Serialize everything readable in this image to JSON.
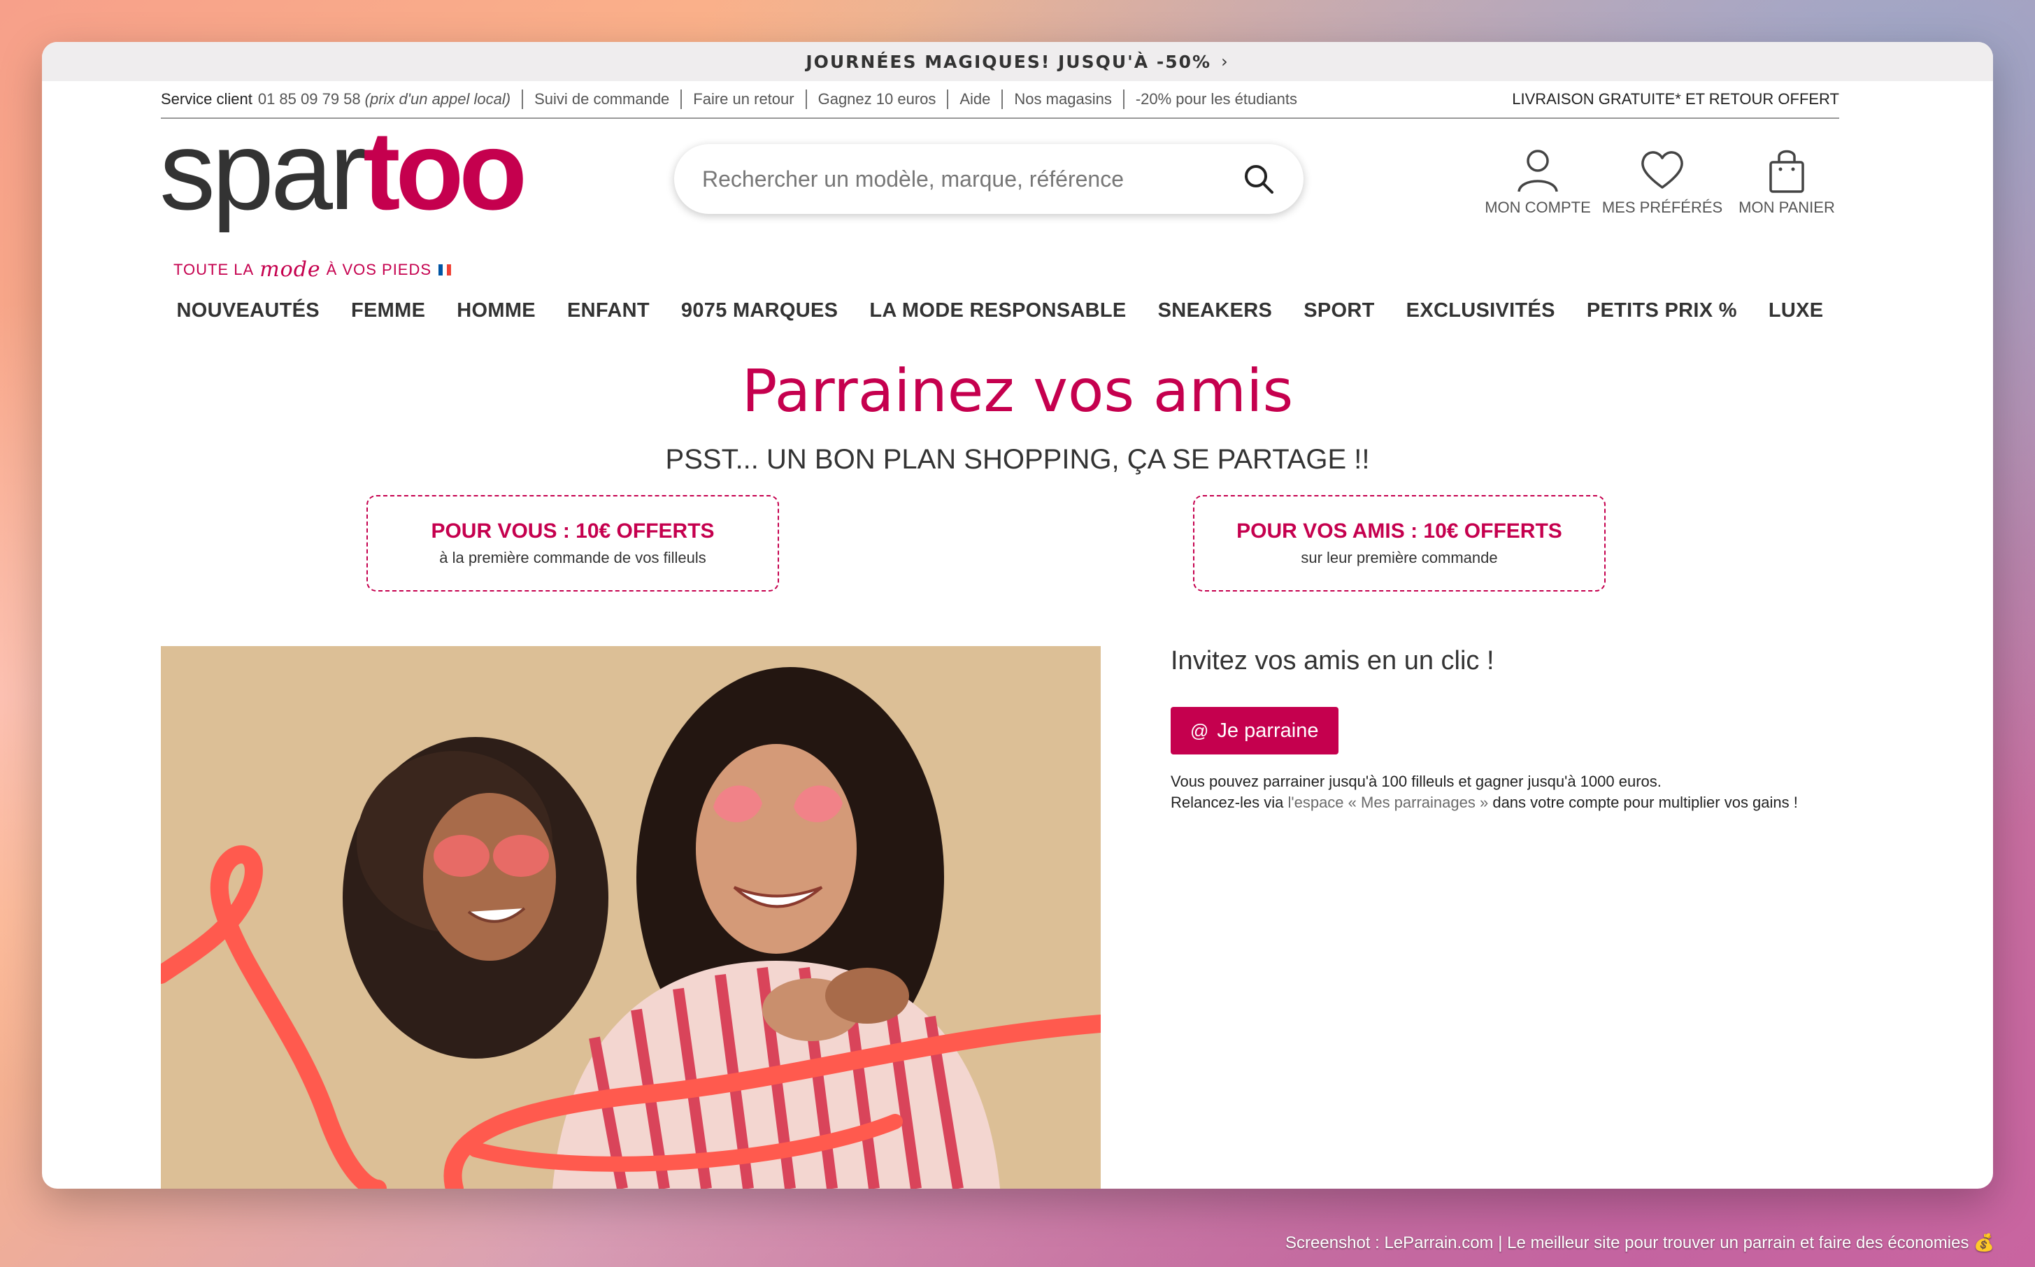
{
  "promo": {
    "text": "JOURNÉES MAGIQUES! JUSQU'À -50%",
    "chevron": "›"
  },
  "topbar": {
    "service_label": "Service client",
    "phone": "01 85 09 79 58",
    "phone_note": "(prix d'un appel local)",
    "links": [
      "Suivi de commande",
      "Faire un retour",
      "Gagnez 10 euros",
      "Aide",
      "Nos magasins",
      "-20% pour les étudiants"
    ],
    "right_text": "LIVRAISON GRATUITE* ET RETOUR OFFERT"
  },
  "logo": {
    "part1": "spar",
    "part2": "too",
    "tagline_a": "TOUTE LA",
    "tagline_mode": "mode",
    "tagline_b": "À VOS PIEDS"
  },
  "search": {
    "placeholder": "Rechercher un modèle, marque, référence",
    "icon": "search-icon"
  },
  "account": {
    "items": [
      {
        "label": "MON COMPTE",
        "icon": "user-icon"
      },
      {
        "label": "MES PRÉFÉRÉS",
        "icon": "heart-icon"
      },
      {
        "label": "MON PANIER",
        "icon": "shopping-bag-icon"
      }
    ]
  },
  "nav": {
    "items": [
      "NOUVEAUTÉS",
      "FEMME",
      "HOMME",
      "ENFANT",
      "9075 MARQUES",
      "LA MODE RESPONSABLE",
      "SNEAKERS",
      "SPORT",
      "EXCLUSIVITÉS",
      "PETITS PRIX %",
      "LUXE"
    ]
  },
  "hero": {
    "title": "Parrainez vos amis",
    "subtitle": "PSST... UN BON PLAN SHOPPING, ÇA SE PARTAGE !!"
  },
  "offers": [
    {
      "title": "POUR VOUS : 10€ OFFERTS",
      "subtitle": "à la première commande de vos filleuls"
    },
    {
      "title": "POUR VOS AMIS : 10€ OFFERTS",
      "subtitle": "sur leur première commande"
    }
  ],
  "invite": {
    "title": "Invitez vos amis en un clic !",
    "button_icon": "@",
    "button_label": "Je parraine",
    "text1": "Vous pouvez parrainer jusqu'à 100 filleuls et gagner jusqu'à 1000 euros.",
    "text2_a": "Relancez-les via ",
    "text2_link": "l'espace « Mes parrainages »",
    "text2_b": " dans votre compte pour multiplier vos gains !"
  },
  "caption": "Screenshot : LeParrain.com | Le meilleur site pour trouver un parrain et faire des économies 💰",
  "colors": {
    "brand": "#c5004e",
    "text": "#333333",
    "promo_bg": "#efedee",
    "flag_blue": "#0055a4",
    "flag_red": "#ef4135"
  }
}
